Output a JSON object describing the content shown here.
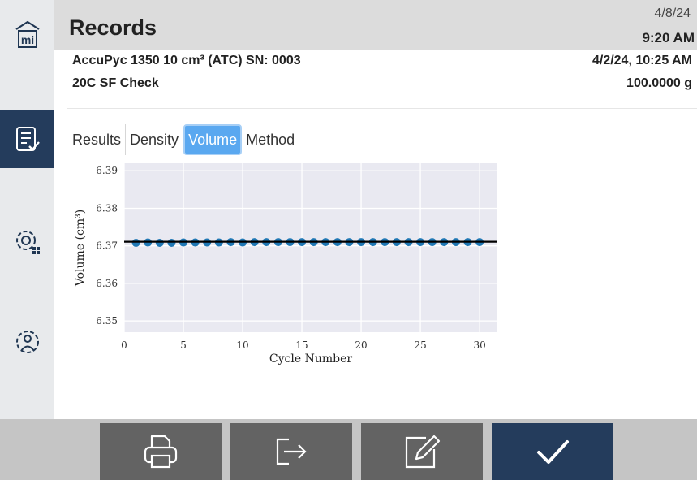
{
  "header": {
    "title": "Records",
    "date": "4/8/24",
    "time": "9:20 AM"
  },
  "record": {
    "instrument": "AccuPyc 1350 10 cm³ (ATC) SN: 0003",
    "sample_name": "20C SF Check",
    "datetime": "4/2/24, 10:25 AM",
    "mass": "100.0000 g"
  },
  "sidebar": {
    "items": [
      {
        "name": "home",
        "icon": "home-building-icon"
      },
      {
        "name": "records",
        "icon": "checklist-icon",
        "active": true
      },
      {
        "name": "instrument-settings",
        "icon": "gear-grid-icon"
      },
      {
        "name": "user-settings",
        "icon": "gear-user-icon"
      }
    ]
  },
  "tabs": [
    {
      "label": "Results"
    },
    {
      "label": "Density"
    },
    {
      "label": "Volume",
      "active": true
    },
    {
      "label": "Method"
    }
  ],
  "chart_data": {
    "type": "scatter",
    "xlabel": "Cycle Number",
    "ylabel": "Volume (cm³)",
    "xlim": [
      0,
      31.5
    ],
    "ylim": [
      6.347,
      6.392
    ],
    "xticks": [
      0,
      5,
      10,
      15,
      20,
      25,
      30
    ],
    "yticks": [
      6.35,
      6.36,
      6.37,
      6.38,
      6.39
    ],
    "x": [
      1,
      2,
      3,
      4,
      5,
      6,
      7,
      8,
      9,
      10,
      11,
      12,
      13,
      14,
      15,
      16,
      17,
      18,
      19,
      20,
      21,
      22,
      23,
      24,
      25,
      26,
      27,
      28,
      29,
      30
    ],
    "y": [
      6.3708,
      6.3709,
      6.3708,
      6.3708,
      6.3709,
      6.3709,
      6.3709,
      6.3709,
      6.371,
      6.3709,
      6.371,
      6.371,
      6.371,
      6.371,
      6.371,
      6.371,
      6.371,
      6.371,
      6.371,
      6.371,
      6.371,
      6.371,
      6.371,
      6.371,
      6.371,
      6.371,
      6.371,
      6.371,
      6.371,
      6.371
    ],
    "mean_line": 6.3711,
    "grid": true,
    "point_color": "#1f77b4",
    "plot_bg": "#e9e9f1"
  },
  "footer": {
    "buttons": [
      {
        "name": "print",
        "icon": "printer-icon"
      },
      {
        "name": "export",
        "icon": "export-arrow-icon"
      },
      {
        "name": "edit",
        "icon": "edit-pencil-icon"
      },
      {
        "name": "confirm",
        "icon": "checkmark-icon"
      }
    ]
  },
  "colors": {
    "accent": "#5aa8f0",
    "nav_active": "#243c5c",
    "footer_button": "#636363"
  }
}
